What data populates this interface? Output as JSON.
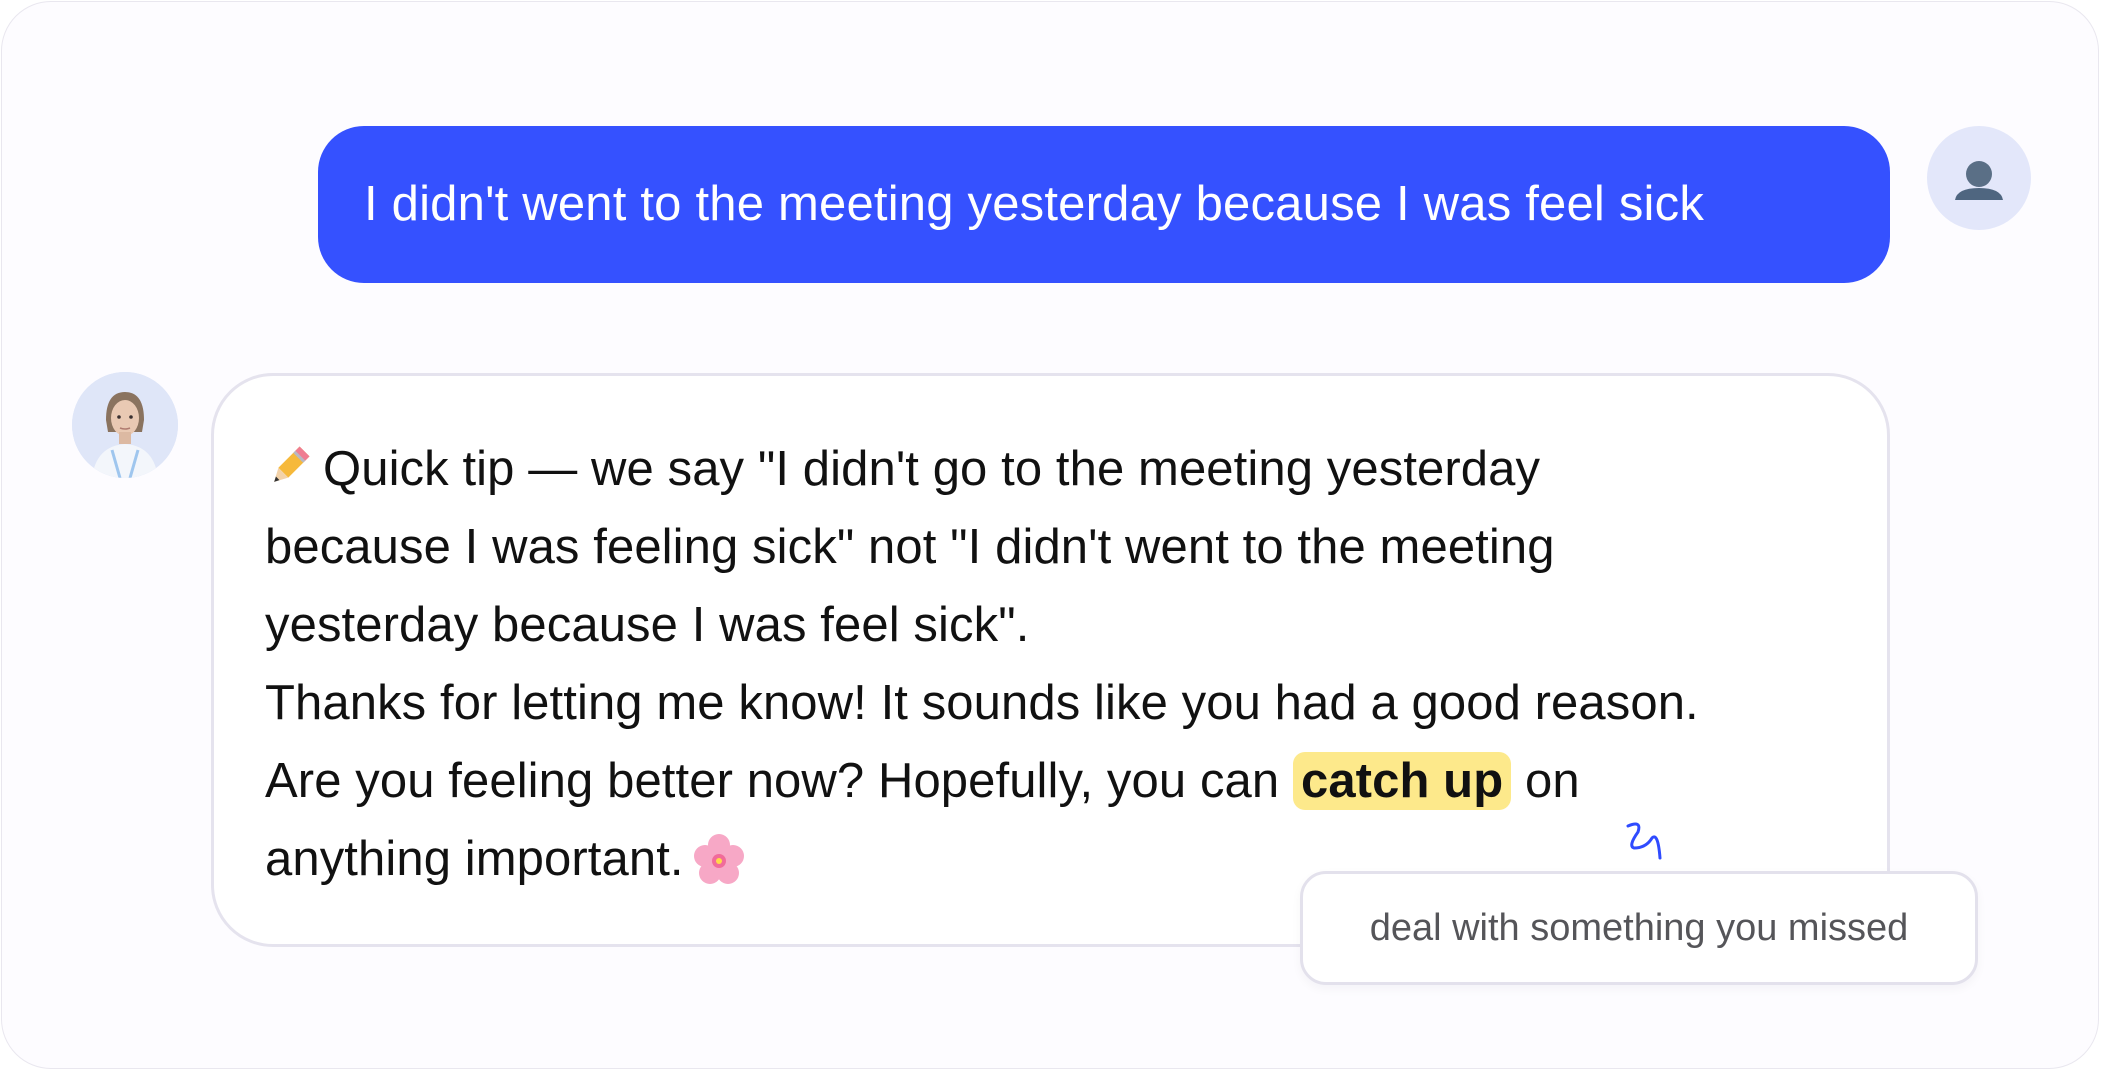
{
  "colors": {
    "user_bubble": "#3551ff",
    "highlight": "#fde98b",
    "squiggle": "#2f4bff"
  },
  "user_message": {
    "text": "I didn't went to the meeting yesterday because I was feel sick",
    "avatar_icon": "user-silhouette-icon"
  },
  "bot_message": {
    "avatar_icon": "bot-portrait-avatar",
    "emoji_start": "pencil-emoji-icon",
    "line1": "Quick tip — we say \"I didn't go to the meeting yesterday",
    "line2": "because I was feeling sick\" not \"I didn't went to the meeting",
    "line3": "yesterday because I was feel sick\".",
    "line4": "Thanks for letting me know! It sounds like you had a good reason.",
    "line5_before": "Are you feeling better now? Hopefully, you can ",
    "highlight": "catch up",
    "line5_after": " on",
    "line6": "anything important.",
    "emoji_end": "cherry-blossom-emoji-icon"
  },
  "tooltip": {
    "text": "deal with something you missed",
    "pointer_icon": "squiggle-arrow-icon"
  }
}
